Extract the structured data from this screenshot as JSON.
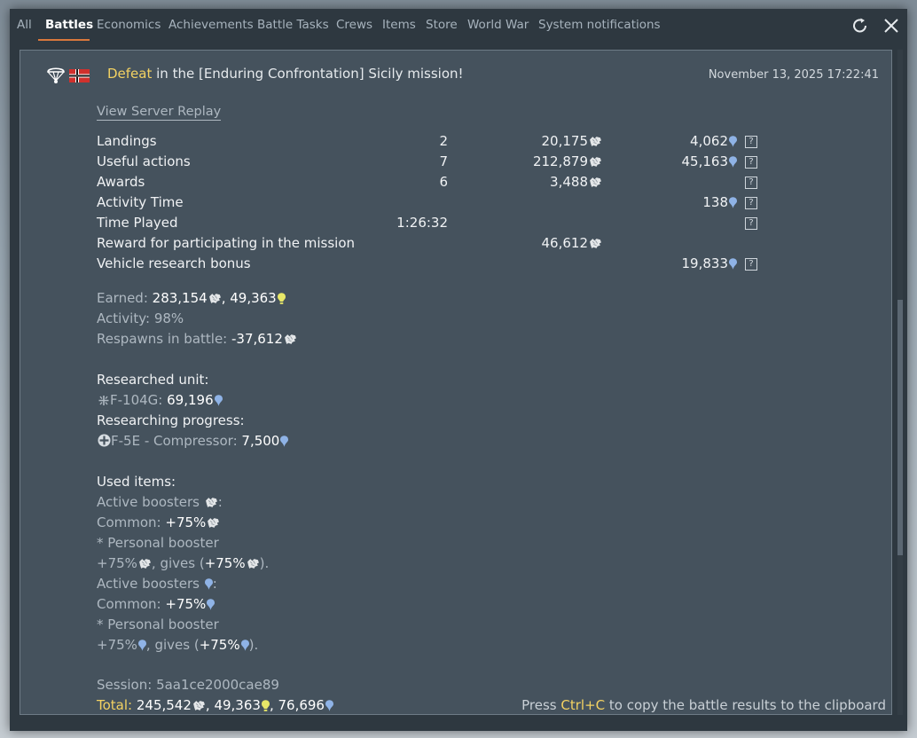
{
  "tabs": [
    {
      "label": "All",
      "active": false
    },
    {
      "label": "Battles",
      "active": true
    },
    {
      "label": "Economics",
      "active": false
    },
    {
      "label": "Achievements",
      "active": false
    },
    {
      "label": "Battle Tasks",
      "active": false
    },
    {
      "label": "Crews",
      "active": false
    },
    {
      "label": "Items",
      "active": false
    },
    {
      "label": "Store",
      "active": false
    },
    {
      "label": "World War",
      "active": false
    },
    {
      "label": "System notifications",
      "active": false
    }
  ],
  "window_controls": {
    "refresh_icon": "refresh-icon",
    "close_icon": "close-icon"
  },
  "message": {
    "result_word": "Defeat",
    "headline_rest": " in the [Enduring Confrontation] Sicily mission!",
    "timestamp": "November 13, 2025 17:22:41",
    "replay_link": "View Server Replay",
    "type_icon": "parachute-icon",
    "nation_icon": "germany-flag-icon"
  },
  "results": [
    {
      "label": "Landings",
      "count": "2",
      "sl": "20,175",
      "rp": "4,062",
      "help": true
    },
    {
      "label": "Useful actions",
      "count": "7",
      "sl": "212,879",
      "rp": "45,163",
      "help": true
    },
    {
      "label": "Awards",
      "count": "6",
      "sl": "3,488",
      "rp": "",
      "help": true
    },
    {
      "label": "Activity Time",
      "count": "",
      "sl": "",
      "rp": "138",
      "help": true
    },
    {
      "label": "Time Played",
      "count": "1:26:32",
      "sl": "",
      "rp": "",
      "help": true
    },
    {
      "label": "Reward for participating in the mission",
      "count": "",
      "sl": "46,612",
      "rp": "",
      "help": false
    },
    {
      "label": "Vehicle research bonus",
      "count": "",
      "sl": "",
      "rp": "19,833",
      "help": true
    }
  ],
  "help_glyph": "?",
  "summary": {
    "earned_label": "Earned: ",
    "earned_sl": "283,154",
    "earned_sep": ", ",
    "earned_crp": "49,363",
    "activity_label": "Activity: ",
    "activity_value": "98%",
    "respawns_label": "Respawns in battle: ",
    "respawns_value": "-37,612"
  },
  "research": {
    "researched_title": "Researched unit:",
    "researched_unit": "F-104G: ",
    "researched_value": "69,196",
    "progress_title": "Researching progress:",
    "progress_unit": "F-5E - Compressor: ",
    "progress_value": "7,500"
  },
  "items": {
    "title": "Used items:",
    "active_sl": "Active boosters ",
    "colon": ":",
    "common_label": "Common: ",
    "common_value": "+75%",
    "personal": "* Personal booster",
    "personal_pct": "+75%",
    "gives_label": ", gives (",
    "gives_value": "+75%",
    "gives_close": ")."
  },
  "footer": {
    "session_label": "Session: ",
    "session_id": "5aa1ce2000cae89",
    "total_label": "Total: ",
    "total_sl": "245,542",
    "sep": ", ",
    "total_crp": "49,363",
    "total_rp": "76,696",
    "hint_pre": "Press ",
    "hint_key": "Ctrl+C",
    "hint_post": " to copy the battle results to the clipboard"
  },
  "colors": {
    "accent_yellow": "#f3d262",
    "tab_underline": "#d9783c",
    "rp_blue": "#8fb3e6",
    "crp_yellow": "#e8e868",
    "sl_white": "#e3e6e8"
  }
}
